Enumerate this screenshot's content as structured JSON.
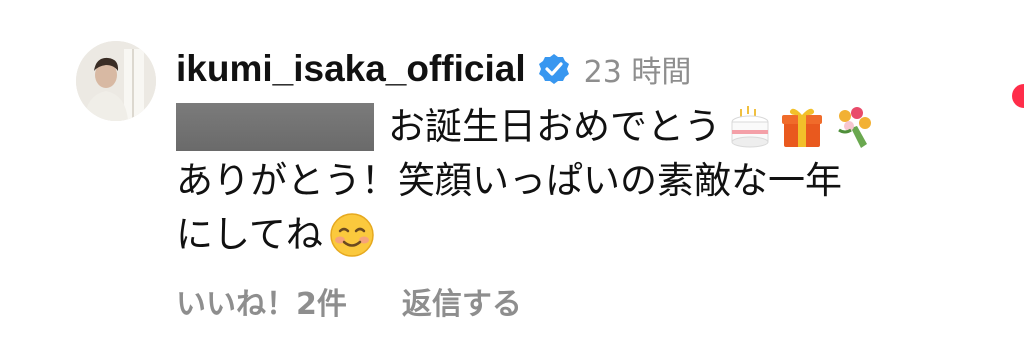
{
  "comment": {
    "author": {
      "username": "ikumi_isaka_official",
      "verified": true,
      "avatar": "profile-photo"
    },
    "timestamp": "23 時間",
    "mention": "redacted-username",
    "lines": [
      "お誕生日おめでとう",
      "ありがとう！笑顔いっぱいの素敵な一年",
      "にしてね"
    ],
    "emojis_line1": [
      "birthday-cake-icon",
      "gift-icon",
      "bouquet-icon"
    ],
    "emojis_line3": [
      "smiling-face-icon"
    ],
    "likes_label": "いいね！2件",
    "reply_label": "返信する"
  },
  "colors": {
    "text": "#111111",
    "muted": "#8e8e8e",
    "verified_badge": "#3897f0",
    "redaction": "#707070",
    "like_indicator": "#ff2d4a"
  }
}
